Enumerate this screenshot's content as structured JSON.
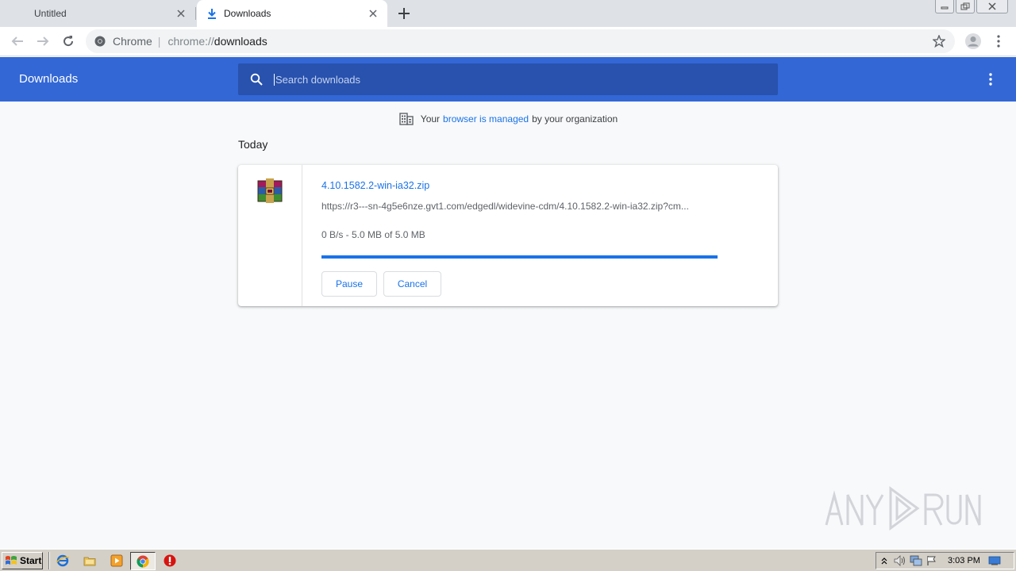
{
  "tabs": [
    {
      "title": "Untitled",
      "active": false
    },
    {
      "title": "Downloads",
      "active": true
    }
  ],
  "omnibox": {
    "site_chip": "Chrome",
    "url_scheme": "chrome://",
    "url_path": "downloads"
  },
  "header": {
    "title": "Downloads",
    "search_placeholder": "Search downloads"
  },
  "managed": {
    "prefix": "Your",
    "link": "browser is managed",
    "suffix": "by your organization"
  },
  "section_date": "Today",
  "download": {
    "file_name": "4.10.1582.2-win-ia32.zip",
    "url": "https://r3---sn-4g5e6nze.gvt1.com/edgedl/widevine-cdm/4.10.1582.2-win-ia32.zip?cm...",
    "status": "0 B/s - 5.0 MB of 5.0 MB",
    "progress_percent": 100,
    "pause_label": "Pause",
    "cancel_label": "Cancel"
  },
  "taskbar": {
    "start_label": "Start",
    "clock": "3:03 PM"
  },
  "colors": {
    "header_bg": "#3367d6",
    "search_bg": "#2852ad",
    "accent": "#1a73e8"
  }
}
